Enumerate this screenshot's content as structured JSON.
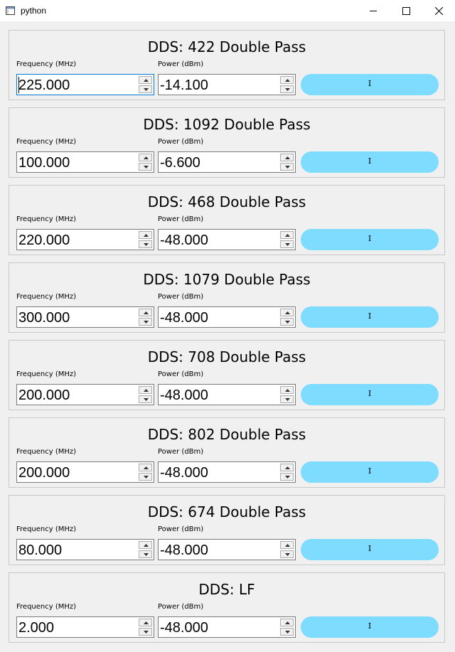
{
  "window": {
    "title": "python"
  },
  "labels": {
    "frequency": "Frequency (MHz)",
    "power": "Power (dBm)"
  },
  "panels": [
    {
      "title": "DDS: 422 Double Pass",
      "frequency": "225.000",
      "power": "-14.100",
      "button": "I"
    },
    {
      "title": "DDS: 1092 Double Pass",
      "frequency": "100.000",
      "power": "-6.600",
      "button": "I"
    },
    {
      "title": "DDS: 468 Double Pass",
      "frequency": "220.000",
      "power": "-48.000",
      "button": "I"
    },
    {
      "title": "DDS: 1079 Double Pass",
      "frequency": "300.000",
      "power": "-48.000",
      "button": "I"
    },
    {
      "title": "DDS: 708 Double Pass",
      "frequency": "200.000",
      "power": "-48.000",
      "button": "I"
    },
    {
      "title": "DDS: 802 Double Pass",
      "frequency": "200.000",
      "power": "-48.000",
      "button": "I"
    },
    {
      "title": "DDS: 674 Double Pass",
      "frequency": "80.000",
      "power": "-48.000",
      "button": "I"
    },
    {
      "title": "DDS: LF",
      "frequency": "2.000",
      "power": "-48.000",
      "button": "I"
    }
  ],
  "colors": {
    "toggle_button": "#7ddcff",
    "focus_border": "#0078d7"
  },
  "icons": {
    "spin_up": "chevron-up-icon",
    "spin_down": "chevron-down-icon"
  }
}
